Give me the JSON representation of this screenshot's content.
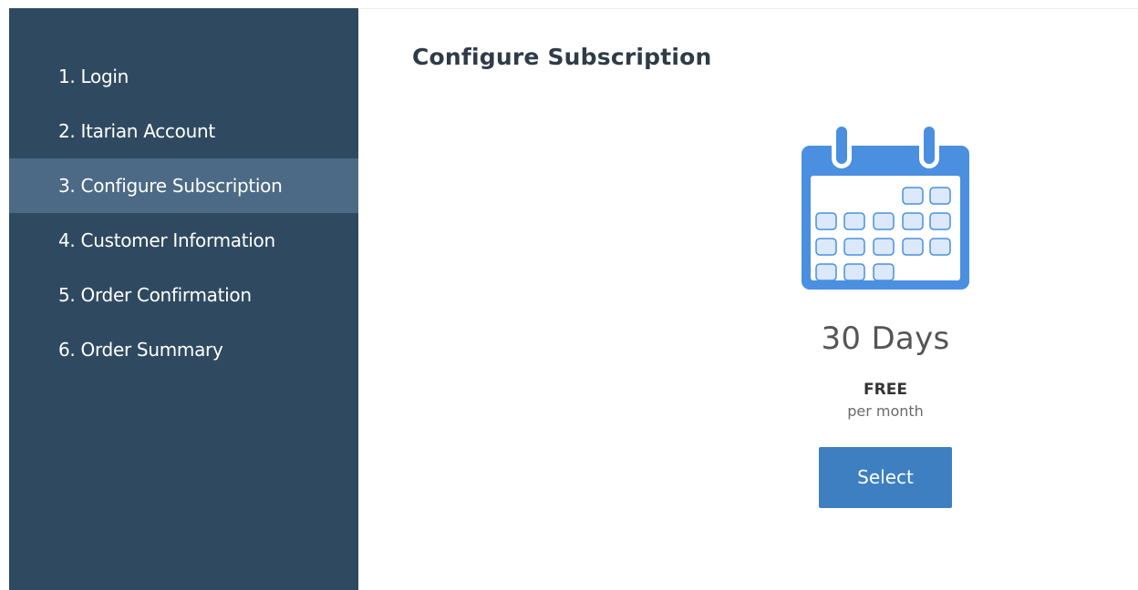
{
  "sidebar": {
    "items": [
      {
        "label": "1. Login",
        "active": false
      },
      {
        "label": "2. Itarian Account",
        "active": false
      },
      {
        "label": "3. Configure Subscription",
        "active": true
      },
      {
        "label": "4. Customer Information",
        "active": false
      },
      {
        "label": "5. Order Confirmation",
        "active": false
      },
      {
        "label": "6. Order Summary",
        "active": false
      }
    ]
  },
  "main": {
    "title": "Configure Subscription",
    "plan": {
      "icon": "calendar-icon",
      "name": "30 Days",
      "price": "FREE",
      "period": "per month",
      "button_label": "Select"
    }
  },
  "colors": {
    "sidebar_bg": "#2f4a60",
    "sidebar_active_bg": "#4c6a85",
    "accent": "#3d7fc1",
    "calendar": "#4a8fe0"
  }
}
